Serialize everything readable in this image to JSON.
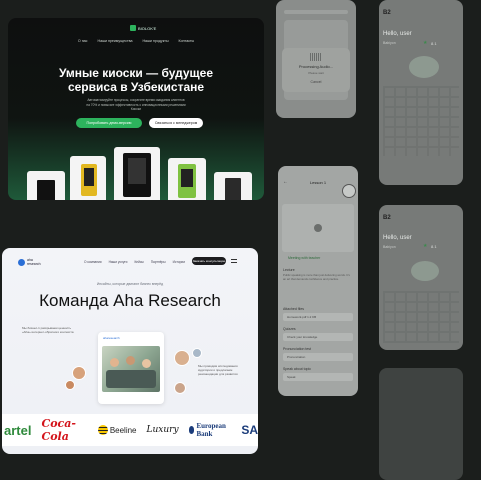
{
  "kiosk": {
    "logo": "BIOLOK'E",
    "nav": [
      "О нас",
      "Наши преимущества",
      "Наши продукты",
      "Контакты"
    ],
    "title_line1": "Умные киоски — будущее",
    "title_line2": "сервиса в Узбекистане",
    "subtitle": "Автоматизируйте процессы, сократите время ожидания клиентов на 70% и повысьте эффективность с инновационными решениями Киоски",
    "primary_button": "Попробовать демо-версию",
    "secondary_button": "Связаться с менеджером"
  },
  "aha": {
    "logo_line1": "aha",
    "logo_line2": "research",
    "nav": [
      "О компании",
      "Наши услуги",
      "Кейсы",
      "Партнёры",
      "Истории",
      "Контакты"
    ],
    "cta": "Заказать консультацию",
    "kicker": "Инсайты, которые двигают бизнес вперёд",
    "title": "Команда Aha Research",
    "left_note": "Мы бизнес-1 раскрываем ценность «Aha» интернет-обратного контекста",
    "right_note": "Мы проводим исследования аудитории и предлагаем рекомендации для развития",
    "photo_logo": "aharesearch",
    "brands": [
      "artel",
      "Coca-Cola",
      "Beeline",
      "Luxury",
      "European Bank",
      "SA"
    ]
  },
  "phone_a": {
    "dialog_title": "Processing Audio...",
    "dialog_sub": "Please wait",
    "cancel": "Cancel"
  },
  "phone_b": {
    "header": "Lesson 1",
    "meeting": "Meeting with teacher",
    "lecture_label": "Lecture",
    "lecture_text": "Public speaking is more than just delivering words. It's an art that demands confidence and practice.",
    "attached_label": "Attached files",
    "file": "Homework.pdf 1.2 KB",
    "quizzes_label": "Quizzes",
    "quiz_item": "Check your knowledge",
    "pron_label": "Pronunciation test",
    "pron_item": "Pronunciation",
    "speak_label": "Speak about topic",
    "speak_item": "Speak"
  },
  "phone_c": {
    "greeting": "Hello, user",
    "name": "Babiyon",
    "score": "8.1",
    "level": "B2"
  },
  "phone_d": {
    "greeting": "Hello, user",
    "name": "Babiyon",
    "score": "8.1",
    "level": "B2"
  }
}
